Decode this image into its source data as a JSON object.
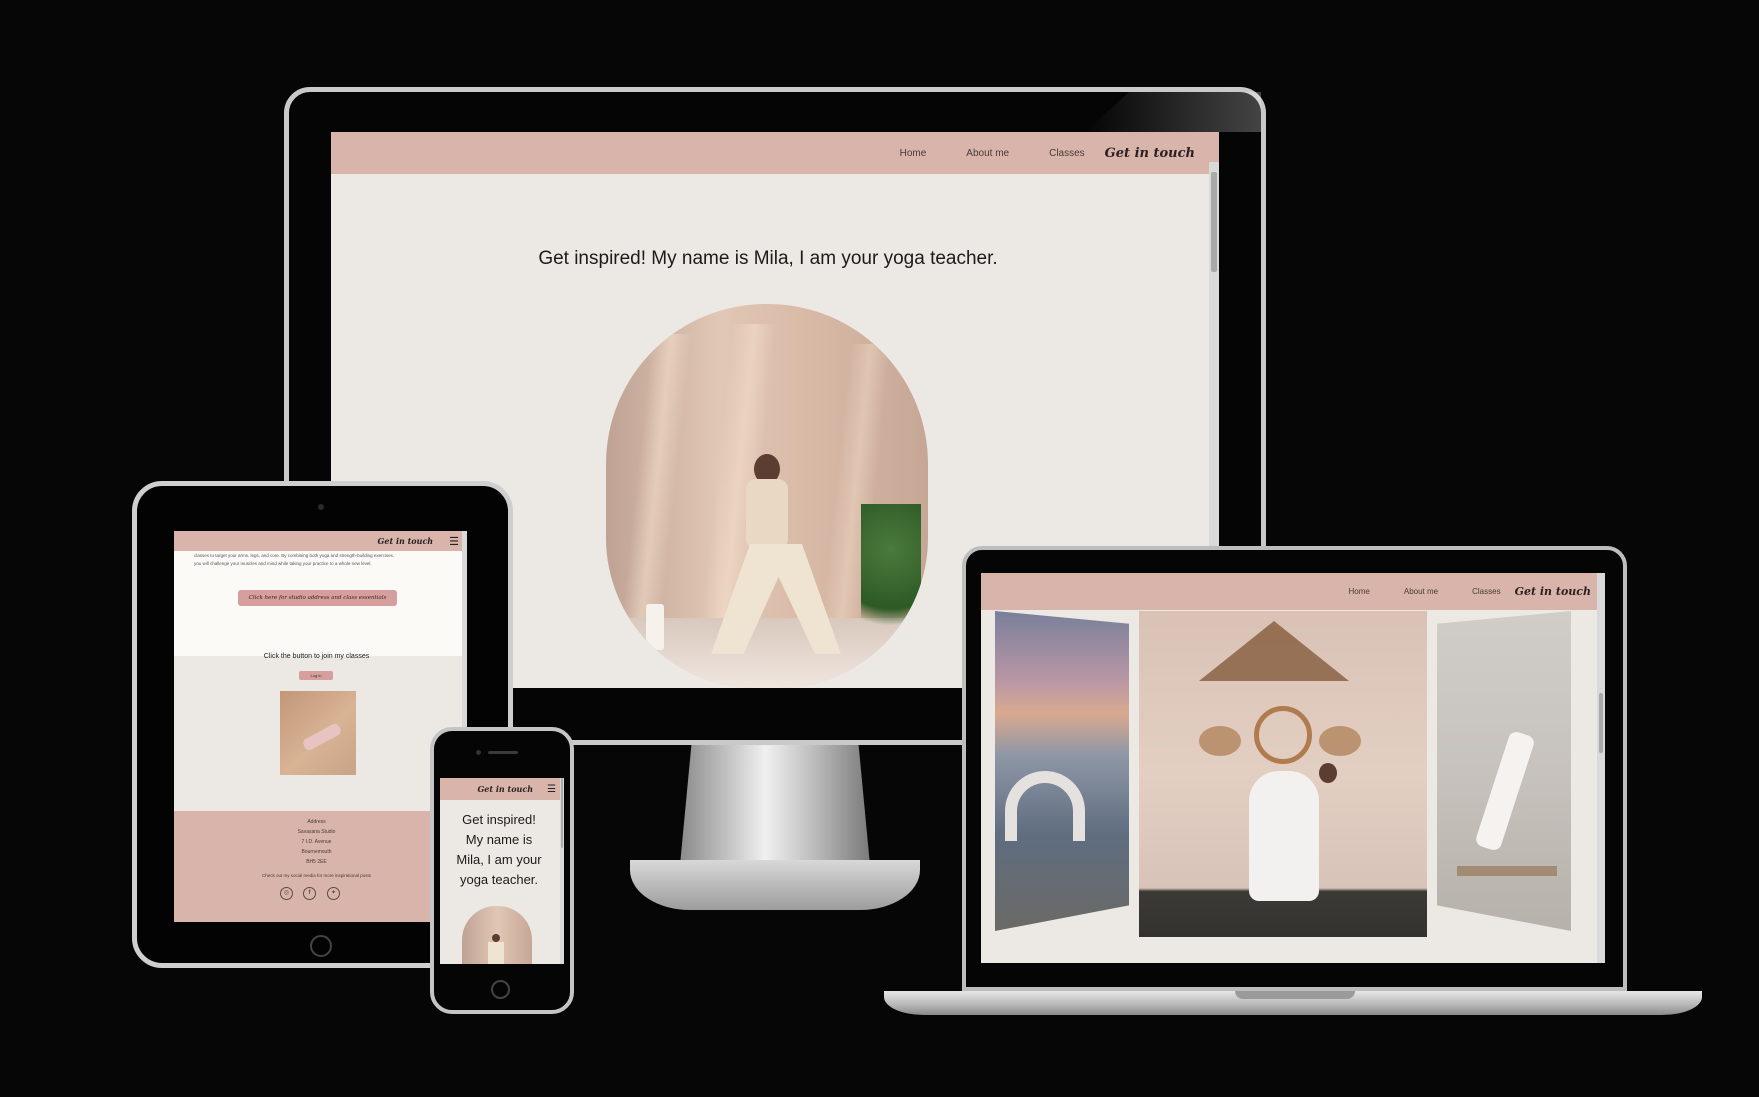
{
  "site": {
    "colors": {
      "nav": "#d8b4aa",
      "page": "#ece8e3",
      "cream": "#fbfaf6",
      "button": "#d69e9c",
      "text": "#1d1b1a"
    },
    "nav": {
      "home": "Home",
      "about": "About me",
      "classes": "Classes",
      "contact": "Get in touch",
      "menu_icon": "hamburger-icon"
    },
    "hero": {
      "headline": "Get inspired! My name is Mila, I am your yoga teacher."
    },
    "about_snippet": {
      "line1": "classes to target your arms, legs, and core. By combining both yoga and strength-building exercises,",
      "line2": "you will challenge your muscles and mind while taking your practice to a whole new level."
    },
    "studio_button": "Click here for studio address and class essentials",
    "join": {
      "text": "Click the button to join my classes",
      "button": "Log in"
    },
    "footer": {
      "address_heading": "Address",
      "address_lines": [
        "Savasana Studio",
        "7 I.D. Avenue",
        "Bournemouth",
        "BH5 2EE"
      ],
      "social_text": "Check out my social media for more inspirational posts",
      "social_icons": [
        "instagram-icon",
        "facebook-icon",
        "twitter-icon"
      ]
    },
    "phone_headline_lines": [
      "Get inspired!",
      "My name is",
      "Mila, I am your",
      "yoga teacher."
    ]
  }
}
